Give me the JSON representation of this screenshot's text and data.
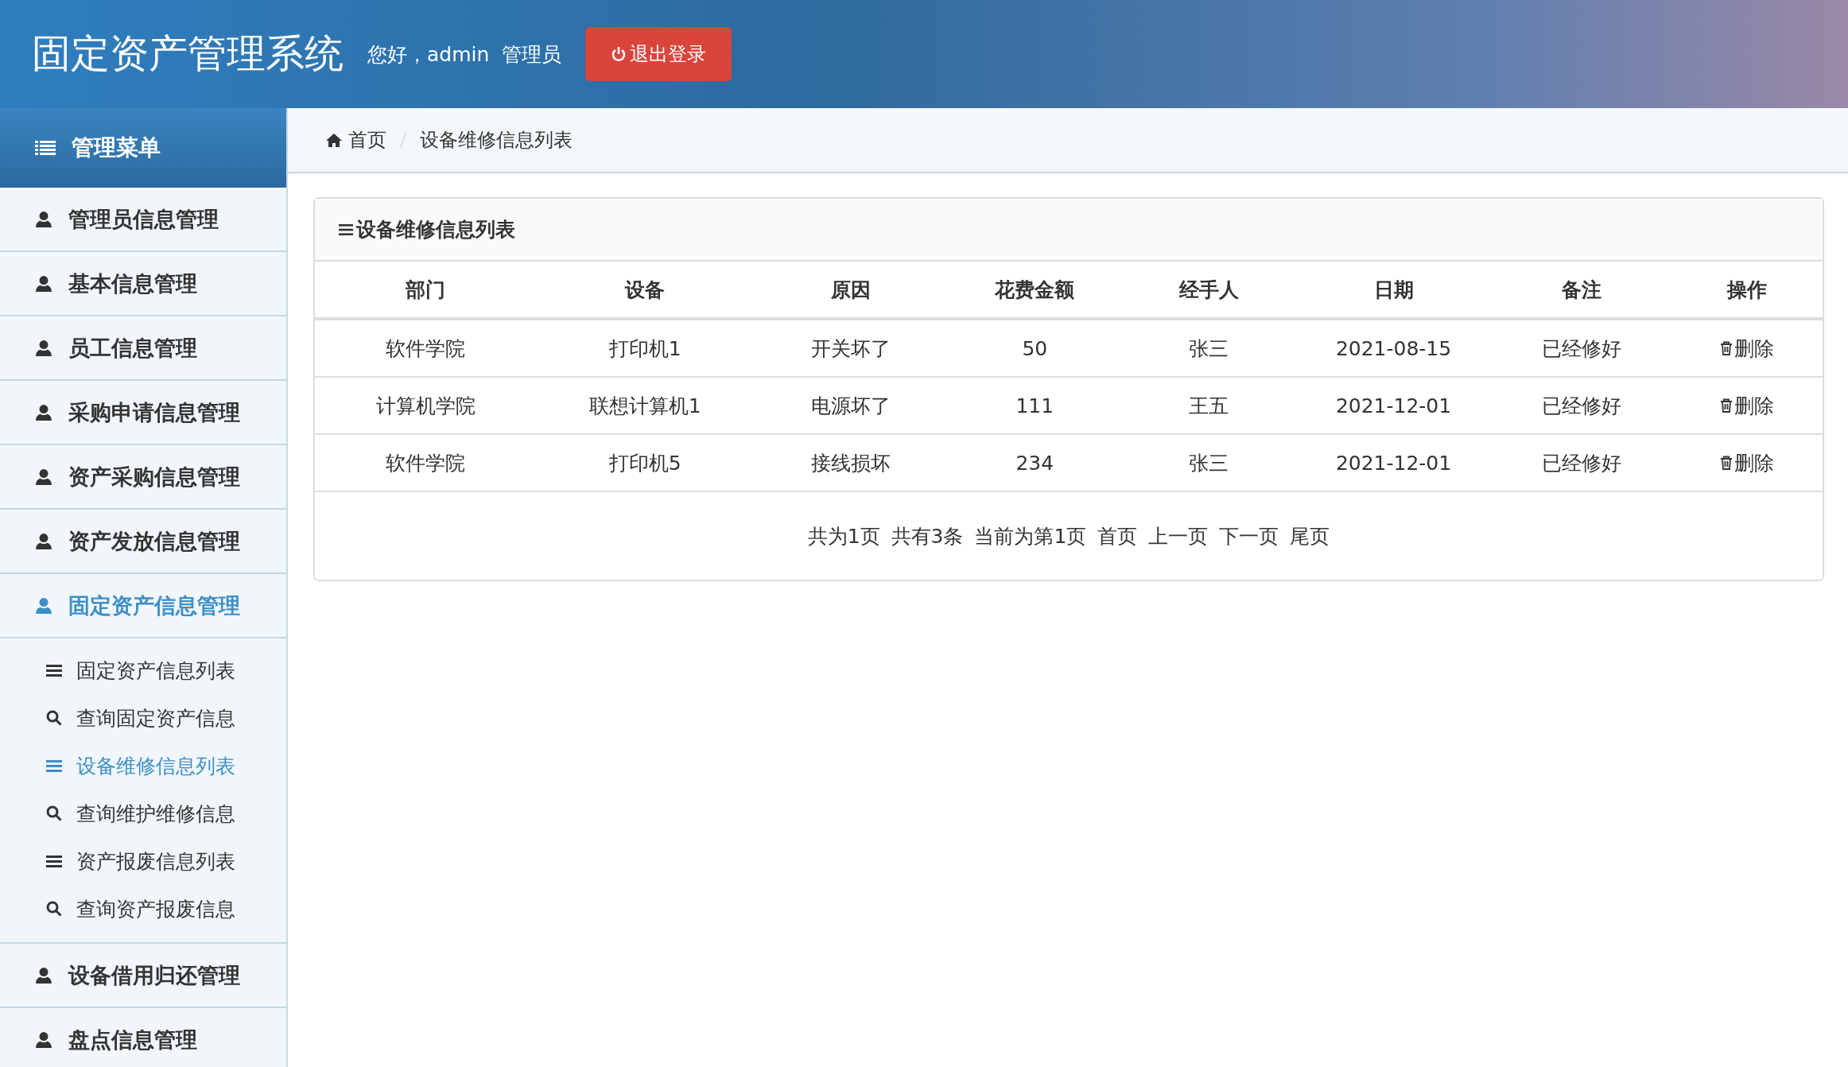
{
  "header": {
    "title": "固定资产管理系统",
    "greeting": "您好，admin  管理员",
    "logout_button": "退出登录"
  },
  "sidebar": {
    "title": "管理菜单",
    "items": [
      {
        "label": "管理员信息管理",
        "selected": false
      },
      {
        "label": "基本信息管理",
        "selected": false
      },
      {
        "label": "员工信息管理",
        "selected": false
      },
      {
        "label": "采购申请信息管理",
        "selected": false
      },
      {
        "label": "资产采购信息管理",
        "selected": false
      },
      {
        "label": "资产发放信息管理",
        "selected": false
      },
      {
        "label": "固定资产信息管理",
        "selected": true,
        "expanded": true,
        "children": [
          {
            "label": "固定资产信息列表",
            "kind": "list",
            "selected": false
          },
          {
            "label": "查询固定资产信息",
            "kind": "search",
            "selected": false
          },
          {
            "label": "设备维修信息列表",
            "kind": "list",
            "selected": true
          },
          {
            "label": "查询维护维修信息",
            "kind": "search",
            "selected": false
          },
          {
            "label": "资产报废信息列表",
            "kind": "list",
            "selected": false
          },
          {
            "label": "查询资产报废信息",
            "kind": "search",
            "selected": false
          }
        ]
      },
      {
        "label": "设备借用归还管理",
        "selected": false
      },
      {
        "label": "盘点信息管理",
        "selected": false
      }
    ]
  },
  "breadcrumb": [
    "首页",
    "设备维修信息列表"
  ],
  "panel": {
    "title": "设备维修信息列表",
    "table": {
      "columns": [
        "部门",
        "设备",
        "原因",
        "花费金额",
        "经手人",
        "日期",
        "备注",
        "操作"
      ],
      "rows": [
        {
          "cells": [
            "软件学院",
            "打印机1",
            "开关坏了",
            "50",
            "张三",
            "2021-08-15",
            "已经修好"
          ],
          "action": "删除"
        },
        {
          "cells": [
            "计算机学院",
            "联想计算机1",
            "电源坏了",
            "111",
            "王五",
            "2021-12-01",
            "已经修好"
          ],
          "action": "删除"
        },
        {
          "cells": [
            "软件学院",
            "打印机5",
            "接线损坏",
            "234",
            "张三",
            "2021-12-01",
            "已经修好"
          ],
          "action": "删除"
        }
      ]
    },
    "pager": {
      "info": [
        "共为1页",
        "共有3条",
        "当前为第1页"
      ],
      "links": [
        "首页",
        "上一页",
        "下一页",
        "尾页"
      ]
    }
  }
}
